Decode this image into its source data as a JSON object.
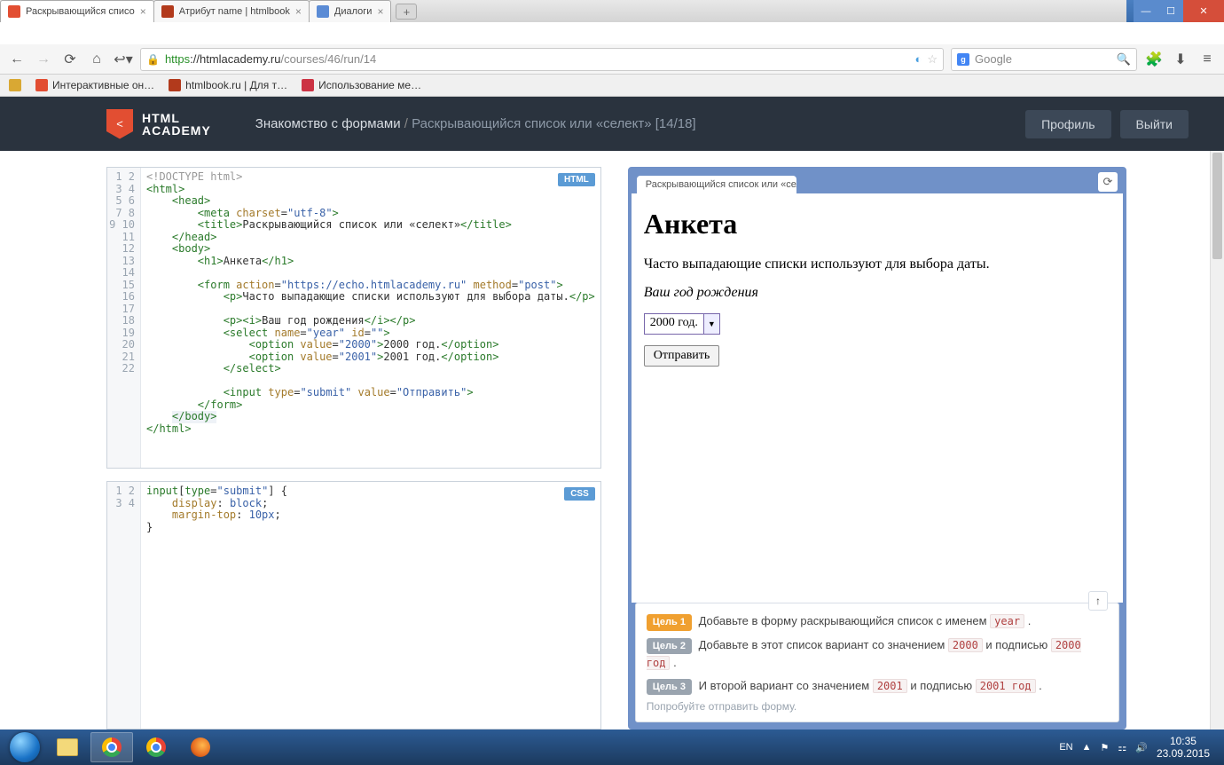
{
  "window": {
    "buttons": {
      "min": "—",
      "max": "☐",
      "close": "✕"
    }
  },
  "tabs": [
    {
      "title": "Раскрывающийся списо",
      "active": true,
      "icon": "#e24e32"
    },
    {
      "title": "Атрибут name | htmlbook",
      "active": false,
      "icon": "#b23a1c"
    },
    {
      "title": "Диалоги",
      "active": false,
      "icon": "#5a8bd5"
    }
  ],
  "nav": {
    "proto": "https",
    "host": "://htmlacademy.ru",
    "path": "/courses/46/run/14",
    "search_placeholder": "Google"
  },
  "bookmarks": [
    {
      "label": "",
      "icon": "#d9a833"
    },
    {
      "label": "Интерактивные он…",
      "icon": "#e24e32"
    },
    {
      "label": "htmlbook.ru | Для т…",
      "icon": "#b23a1c"
    },
    {
      "label": "Использование ме…",
      "icon": "#cc3344"
    }
  ],
  "header": {
    "logo1": "HTML",
    "logo2": "ACADEMY",
    "crumb_main": "Знакомство с формами",
    "crumb_sep": "/",
    "crumb_sub": "Раскрывающийся список или «селект» [14/18]",
    "btn_profile": "Профиль",
    "btn_logout": "Выйти"
  },
  "editors": {
    "html_badge": "HTML",
    "css_badge": "CSS",
    "html_lines": 22,
    "css_lines": 4
  },
  "preview": {
    "tab_title": "Раскрывающийся список или «сел",
    "h1": "Анкета",
    "p": "Часто выпадающие списки используют для выбора даты.",
    "label": "Ваш год рождения",
    "select_value": "2000 год.",
    "submit": "Отправить"
  },
  "goals": {
    "g1_badge": "Цель 1",
    "g1_text": "Добавьте в форму раскрывающийся список с именем ",
    "g1_code": "year",
    "g2_badge": "Цель 2",
    "g2_text": "Добавьте в этот список вариант со значением ",
    "g2_code1": "2000",
    "g2_mid": " и подписью ",
    "g2_code2": "2000 год",
    "g3_badge": "Цель 3",
    "g3_text": "И второй вариант со значением ",
    "g3_code1": "2001",
    "g3_mid": " и подписью ",
    "g3_code2": "2001 год",
    "hint": "Попробуйте отправить форму."
  },
  "tray": {
    "lang": "EN",
    "time": "10:35",
    "date": "23.09.2015"
  }
}
